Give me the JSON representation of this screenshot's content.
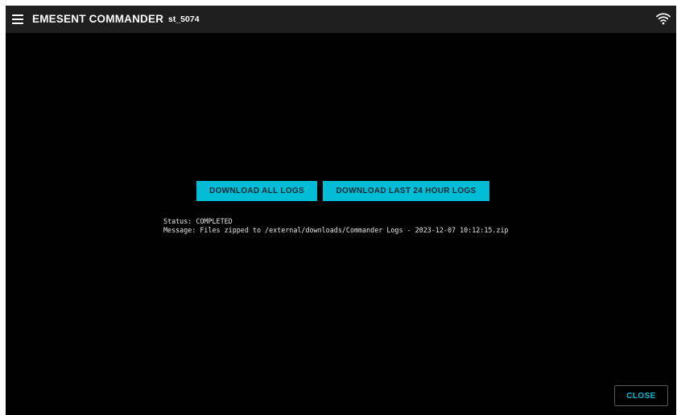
{
  "header": {
    "app_title": "EMESENT COMMANDER",
    "device_id": "st_5074"
  },
  "icons": {
    "menu": "hamburger-menu-icon",
    "connection": "wifi-icon"
  },
  "actions": {
    "download_all_label": "DOWNLOAD ALL LOGS",
    "download_24h_label": "DOWNLOAD LAST 24 HOUR LOGS"
  },
  "status": {
    "status_line": "Status: COMPLETED",
    "message_line": "Message: Files zipped to /external/downloads/Commander Logs - 2023-12-07 10:12:15.zip"
  },
  "footer": {
    "close_label": "CLOSE"
  },
  "colors": {
    "background": "#000000",
    "topbar": "#1f1f1f",
    "accent": "#00bcd4",
    "text": "#ffffff"
  }
}
